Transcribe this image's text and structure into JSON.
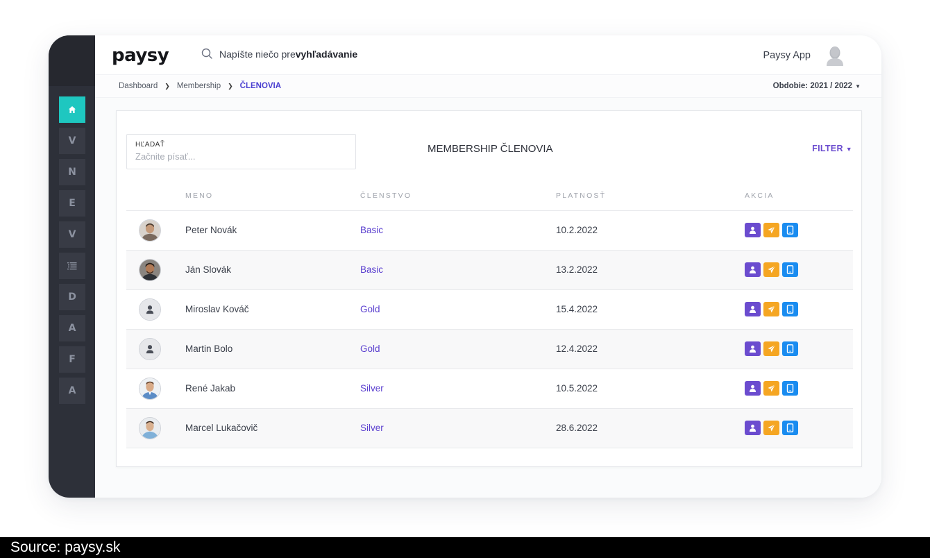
{
  "app": {
    "logo": "paysy",
    "user_name": "Paysy App"
  },
  "search": {
    "prefix": "Napíšte niečo pre ",
    "emphasis": "vyhľadávanie"
  },
  "sidebar": {
    "items": [
      {
        "label": "",
        "icon": "home-icon"
      },
      {
        "label": "V"
      },
      {
        "label": "N"
      },
      {
        "label": "E"
      },
      {
        "label": "V"
      },
      {
        "label": "",
        "icon": "list-icon"
      },
      {
        "label": "D"
      },
      {
        "label": "A"
      },
      {
        "label": "F"
      },
      {
        "label": "A"
      }
    ]
  },
  "breadcrumb": {
    "items": [
      "Dashboard",
      "Membership"
    ],
    "current": "ČLENOVIA"
  },
  "period": {
    "label": "Obdobie: 2021 / 2022"
  },
  "panel": {
    "search_label": "HĽADAŤ",
    "search_placeholder": "Začnite písať...",
    "title": "MEMBERSHIP ČLENOVIA",
    "filter_label": "FILTER"
  },
  "table": {
    "headers": [
      "MENO",
      "ČLENSTVO",
      "PLATNOSŤ",
      "AKCIA"
    ],
    "rows": [
      {
        "name": "Peter Novák",
        "membership": "Basic",
        "validity": "10.2.2022",
        "avatar": "photo-1"
      },
      {
        "name": "Ján Slovák",
        "membership": "Basic",
        "validity": "13.2.2022",
        "avatar": "photo-2"
      },
      {
        "name": "Miroslav Kováč",
        "membership": "Gold",
        "validity": "15.4.2022",
        "avatar": "placeholder"
      },
      {
        "name": "Martin Bolo",
        "membership": "Gold",
        "validity": "12.4.2022",
        "avatar": "placeholder"
      },
      {
        "name": "René Jakab",
        "membership": "Silver",
        "validity": "10.5.2022",
        "avatar": "photo-3"
      },
      {
        "name": "Marcel Lukačovič",
        "membership": "Silver",
        "validity": "28.6.2022",
        "avatar": "photo-4"
      }
    ]
  },
  "colors": {
    "accent": "#1ec7c0",
    "sidebar": "#2d3039",
    "profile_action": "#6b4ccf",
    "send_action": "#f5a623",
    "device_action": "#1a8cf0",
    "link": "#5a3fcf"
  },
  "source": {
    "text": "Source:  paysy.sk"
  }
}
